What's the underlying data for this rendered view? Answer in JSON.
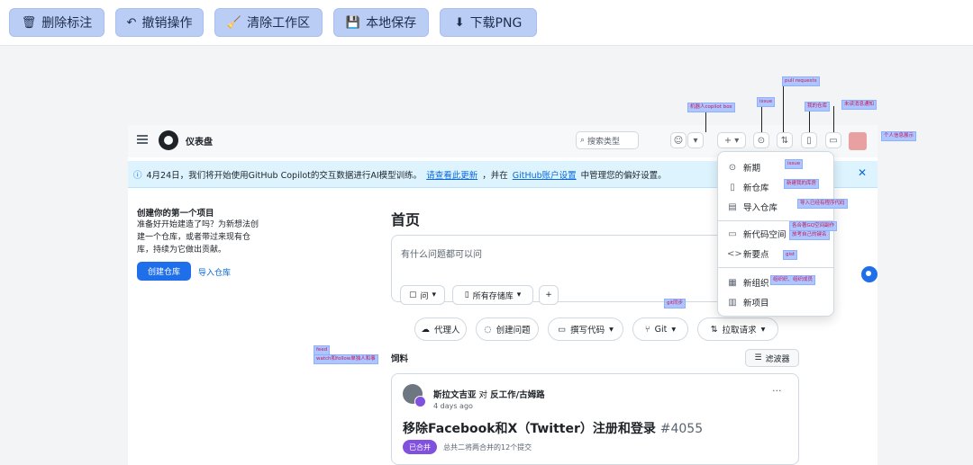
{
  "toolbar": {
    "buttons": [
      {
        "label": "删除标注",
        "icon": "trash-icon"
      },
      {
        "label": "撤销操作",
        "icon": "undo-icon"
      },
      {
        "label": "清除工作区",
        "icon": "broom-icon"
      },
      {
        "label": "本地保存",
        "icon": "floppy-icon"
      },
      {
        "label": "下载PNG",
        "icon": "download-icon"
      }
    ]
  },
  "github": {
    "header": {
      "title": "仪表盘",
      "search_placeholder": "搜索类型"
    },
    "banner": {
      "text": "4月24日，我们将开始使用GitHub Copilot的交互数据进行AI模型训练。",
      "link1": "请查看此更新",
      "mid": "，并在",
      "link2": "GitHub账户设置",
      "tail": "中管理您的偏好设置。"
    },
    "left": {
      "title": "创建你的第一个项目",
      "text": "准备好开始建造了吗？为新想法创建一个仓库，或者带过来现有仓库，持续为它做出贡献。",
      "create_label": "创建仓库",
      "import_label": "导入仓库"
    },
    "main": {
      "home": "首页",
      "ask_placeholder": "有什么问题都可以问",
      "ask_mode": "问",
      "repo_select": "所有存储库",
      "pills": [
        "代理人",
        "创建问题",
        "撰写代码",
        "Git",
        "拉取请求"
      ],
      "feed_label": "饲料",
      "filter_label": "滤波器"
    },
    "card": {
      "user": "斯拉文吉亚",
      "action": "对",
      "repo": "反工作/古姆路",
      "time": "4 days ago",
      "title": "移除Facebook和X（Twitter）注册和登录",
      "number": "#4055",
      "badge": "已合并",
      "desc": "总共二将两合并的12个提交"
    },
    "dropdown": {
      "items": [
        "新期",
        "新仓库",
        "导入仓库",
        "新代码空间",
        "新要点",
        "新组织",
        "新项目"
      ]
    }
  },
  "annotations": [
    "机器人copilot box",
    "issue",
    "pull requests",
    "我的仓库",
    "未读消息通知",
    "个人信息展示",
    "issue",
    "新建我的库房",
    "导入已经有程序代码",
    "各合著GQ空间副作",
    "放考自己的键名",
    "gist",
    "组织织、组织成员",
    "git同步",
    "feed",
    "watch和follow单独人和事"
  ]
}
